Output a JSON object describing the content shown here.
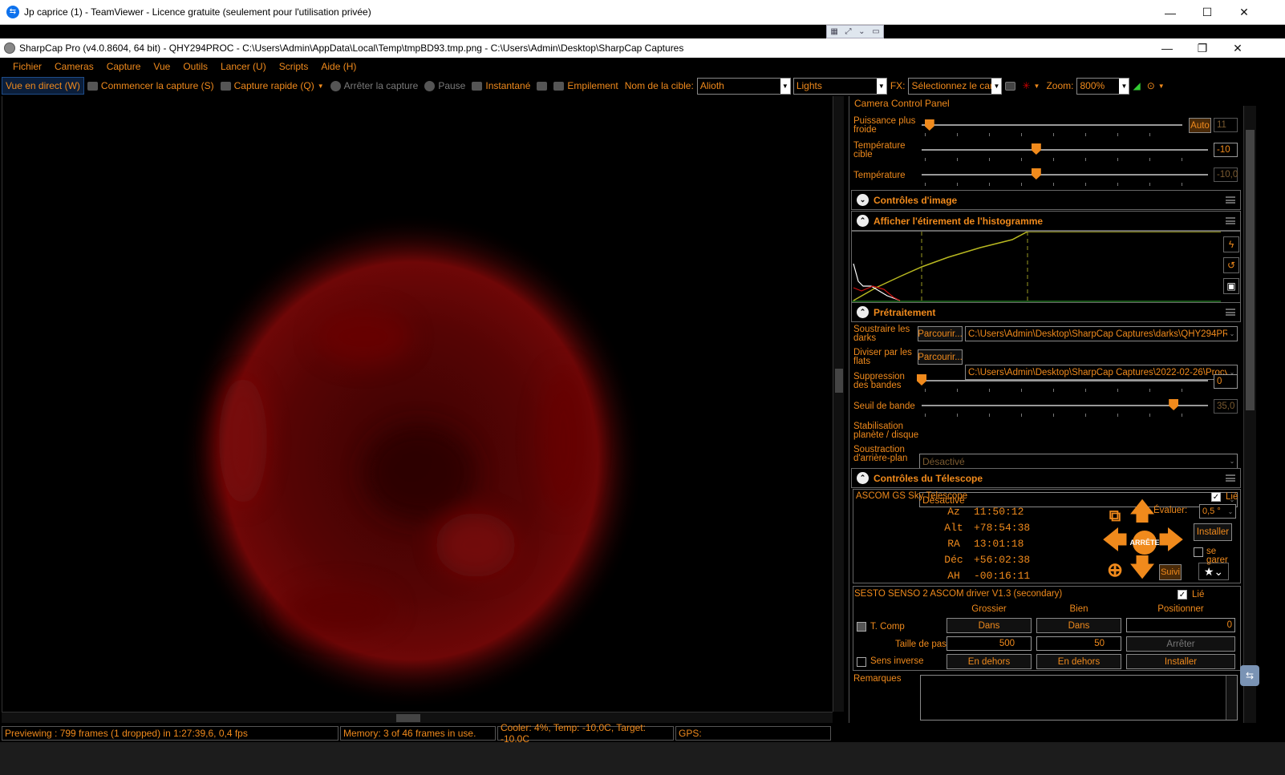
{
  "teamviewer": {
    "title": "Jp caprice (1) - TeamViewer - Licence gratuite (seulement pour l'utilisation privée)"
  },
  "sharpcap": {
    "title": "SharpCap Pro (v4.0.8604, 64 bit) - QHY294PROC - C:\\Users\\Admin\\AppData\\Local\\Temp\\tmpBD93.tmp.png - C:\\Users\\Admin\\Desktop\\SharpCap Captures"
  },
  "menu": [
    "Fichier",
    "Cameras",
    "Capture",
    "Vue",
    "Outils",
    "Lancer (U)",
    "Scripts",
    "Aide (H)"
  ],
  "toolbar": {
    "live_view": "Vue en direct (W)",
    "start_capture": "Commencer la capture (S)",
    "quick_capture": "Capture rapide (Q)",
    "stop_capture": "Arrêter la capture",
    "pause": "Pause",
    "snapshot": "Instantané",
    "stacking": "Empilement",
    "target_label": "Nom de la cible:",
    "target_value": "Alioth",
    "frame_type": "Lights",
    "fx_label": "FX:",
    "fx_value": "Sélectionnez le car",
    "zoom_label": "Zoom:",
    "zoom_value": "800%"
  },
  "panel": {
    "title": "Camera Control Panel",
    "cooler": {
      "power_label": "Puissance plus froide",
      "power_auto": "Auto",
      "power_value": "11",
      "power_level": 0.03,
      "target_temp_label": "Température cible",
      "target_temp_value": "-10",
      "target_temp_level": 0.4,
      "temp_label": "Température",
      "temp_value": "-10,0",
      "temp_level": 0.4
    },
    "image_controls": "Contrôles d'image",
    "histogram": "Afficher l'étirement de l'histogramme",
    "preprocessing": {
      "title": "Prétraitement",
      "darks_label": "Soustraire les darks",
      "darks_browse": "Parcourir...",
      "darks_path": "C:\\Users\\Admin\\Desktop\\SharpCap Captures\\darks\\QHY294PR...",
      "flats_label": "Diviser par les flats",
      "flats_browse": "Parcourir...",
      "flats_path": "C:\\Users\\Admin\\Desktop\\SharpCap Captures\\2022-02-26\\Procy...",
      "banding_label": "Suppression des bandes",
      "banding_value": "0",
      "banding_level": 0,
      "threshold_label": "Seuil de bande",
      "threshold_value": "35,0",
      "threshold_level": 0.88,
      "stabilisation_label": "Stabilisation planète / disque",
      "stabilisation_value": "Désactivé",
      "bg_sub_label": "Soustraction d'arrière-plan",
      "bg_sub_value": "Désactivé"
    },
    "telescope": {
      "title": "Contrôles du Télescope",
      "mount_name": "ASCOM GS Sky Telescope",
      "linked": "Lié",
      "coords": [
        {
          "k": "Az",
          "v": "11:50:12"
        },
        {
          "k": "Alt",
          "v": "+78:54:38"
        },
        {
          "k": "RA",
          "v": "13:01:18"
        },
        {
          "k": "Déc",
          "v": "+56:02:38"
        },
        {
          "k": "AH",
          "v": "-00:16:11"
        }
      ],
      "rate_label": "Évaluer:",
      "rate_value": "0,5 °",
      "install": "Installer",
      "park": "se garer",
      "stop": "ARRÊTE",
      "tracking": "Suivi"
    },
    "focuser": {
      "name": "SESTO SENSO 2 ASCOM driver V1.3 (secondary)",
      "linked": "Lié",
      "col_coarse": "Grossier",
      "col_fine": "Bien",
      "col_position": "Positionner",
      "tcomp": "T. Comp",
      "in_coarse": "Dans",
      "in_fine": "Dans",
      "position_value": "0",
      "step_label": "Taille de pas",
      "step_coarse": "500",
      "step_fine": "50",
      "stop": "Arrêter",
      "reverse": "Sens inverse",
      "out_coarse": "En dehors",
      "out_fine": "En dehors",
      "install": "Installer"
    },
    "notes_label": "Remarques"
  },
  "status": {
    "preview": "Previewing : 799 frames (1 dropped) in 1:27:39,6, 0,4 fps",
    "memory": "Memory: 3 of 46 frames in use.",
    "cooler": "Cooler: 4%, Temp: -10,0C, Target: -10,0C",
    "gps": "GPS:"
  },
  "colors": {
    "accent": "#f08a1c",
    "background": "#000000",
    "image": "#8a0b0b"
  }
}
